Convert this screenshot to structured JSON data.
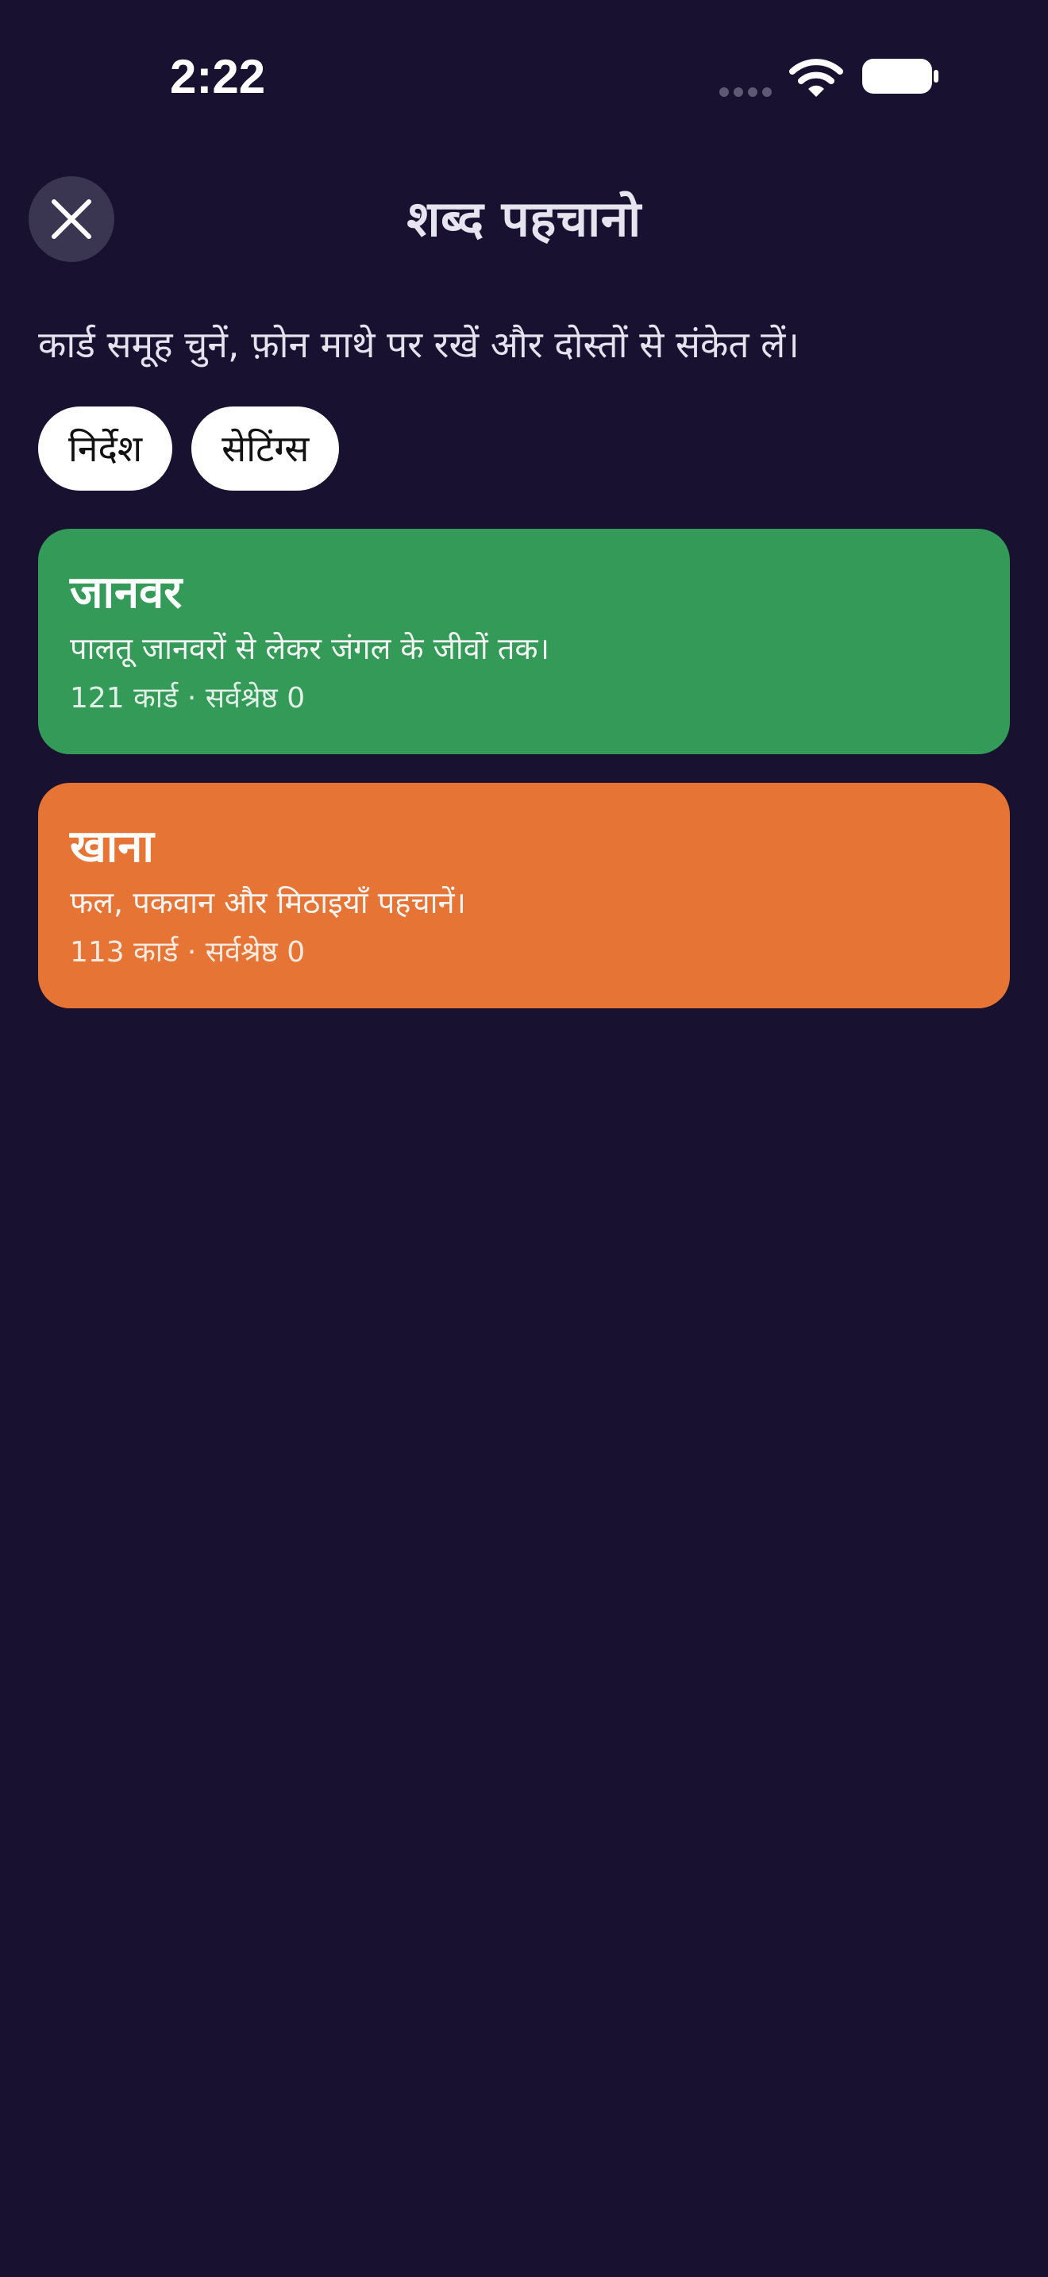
{
  "status_bar": {
    "time": "2:22",
    "icons": [
      "signal-dots-icon",
      "wifi-icon",
      "battery-icon"
    ]
  },
  "header": {
    "close_icon": "close-icon",
    "title": "शब्द पहचानो"
  },
  "subtitle": "कार्ड समूह चुनें, फ़ोन माथे पर रखें और दोस्तों से संकेत लें।",
  "chips": [
    {
      "label": "निर्देश"
    },
    {
      "label": "सेटिंग्स"
    }
  ],
  "decks": [
    {
      "title": "जानवर",
      "description": "पालतू जानवरों से लेकर जंगल के जीवों तक।",
      "meta": "121 कार्ड · सर्वश्रेष्ठ 0",
      "color": "#339a57"
    },
    {
      "title": "खाना",
      "description": "फल, पकवान और मिठाइयाँ पहचानें।",
      "meta": "113 कार्ड · सर्वश्रेष्ठ 0",
      "color": "#e67535"
    }
  ],
  "colors": {
    "background": "#181130",
    "close_button_bg": "#3a3550",
    "chip_bg": "#ffffff"
  }
}
